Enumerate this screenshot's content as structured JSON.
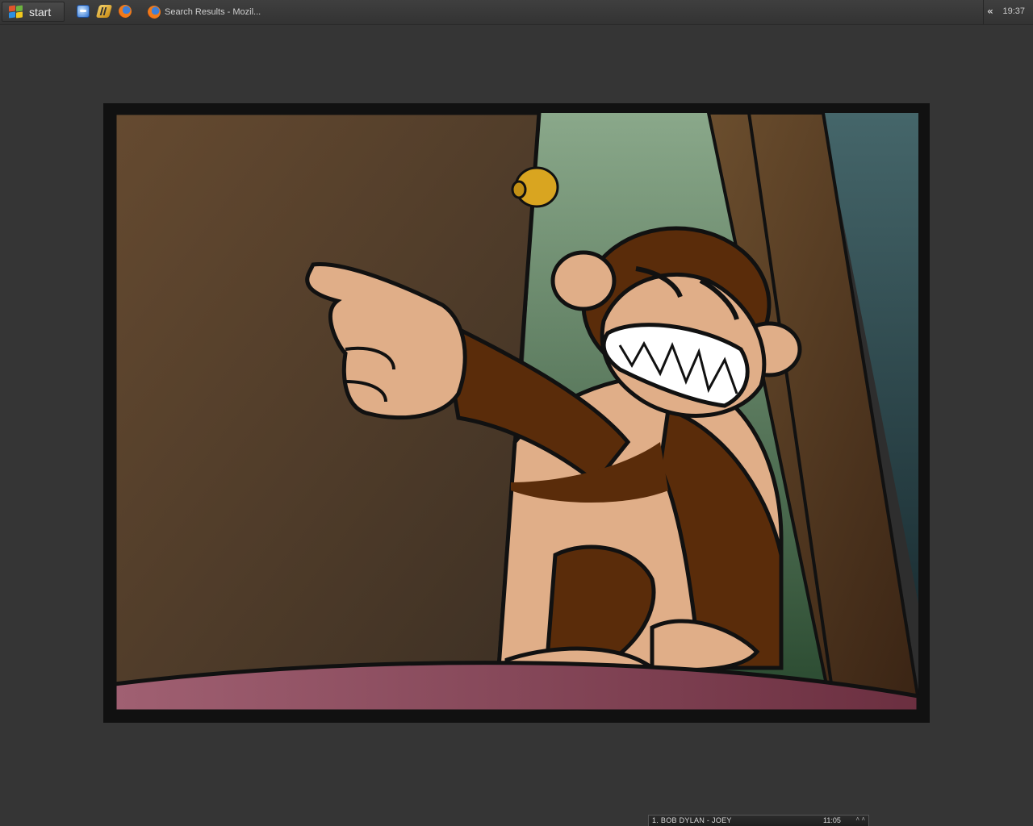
{
  "taskbar": {
    "start_label": "start",
    "quick_launch": [
      {
        "icon": "internet-explorer-icon"
      },
      {
        "icon": "media-player-icon"
      },
      {
        "icon": "firefox-icon"
      }
    ],
    "tasks": [
      {
        "icon": "firefox-icon",
        "label": "Search Results - Mozil..."
      }
    ],
    "tray": {
      "expand_glyph": "«",
      "clock": "19:37"
    }
  },
  "desktop": {
    "background_color": "#353535",
    "wallpaper_subject": "evil-monkey-cartoon"
  },
  "media_player": {
    "track": "1. BOB DYLAN - JOEY",
    "time": "11:05",
    "controls": "˄ ˄"
  }
}
